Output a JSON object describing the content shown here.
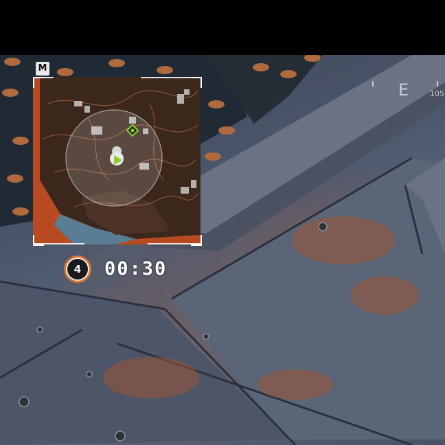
{
  "hud": {
    "map_key": "M",
    "ring_round": "4",
    "ring_timer": "00:30",
    "compass_letter": "E",
    "compass_bearing": "105"
  },
  "colors": {
    "ring_accent": "#d9722e",
    "minimap_zone": "#b84a22",
    "squad_marker": "#8ccf2a"
  },
  "icons": {
    "player_marker": "player-arrow-icon",
    "squad_ping": "squad-ping-icon"
  }
}
